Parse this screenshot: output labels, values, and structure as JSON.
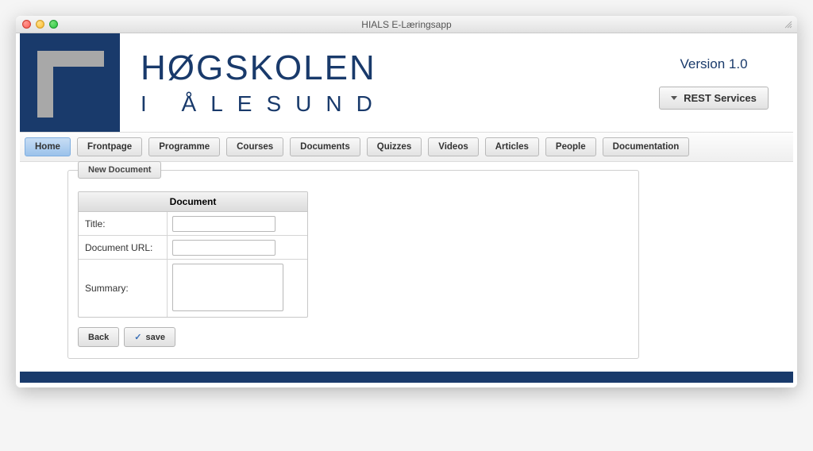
{
  "window": {
    "title": "HIALS E-Læringsapp"
  },
  "header": {
    "brand_top": "HØGSKOLEN",
    "brand_bottom": "I ÅLESUND",
    "version": "Version 1.0",
    "rest_button": "REST Services"
  },
  "tabs": [
    {
      "label": "Home",
      "active": true
    },
    {
      "label": "Frontpage",
      "active": false
    },
    {
      "label": "Programme",
      "active": false
    },
    {
      "label": "Courses",
      "active": false
    },
    {
      "label": "Documents",
      "active": false
    },
    {
      "label": "Quizzes",
      "active": false
    },
    {
      "label": "Videos",
      "active": false
    },
    {
      "label": "Articles",
      "active": false
    },
    {
      "label": "People",
      "active": false
    },
    {
      "label": "Documentation",
      "active": false
    }
  ],
  "panel": {
    "tab_label": "New Document",
    "form_header": "Document",
    "fields": {
      "title_label": "Title:",
      "title_value": "",
      "url_label": "Document URL:",
      "url_value": "",
      "summary_label": "Summary:",
      "summary_value": ""
    },
    "buttons": {
      "back": "Back",
      "save": "save"
    }
  }
}
